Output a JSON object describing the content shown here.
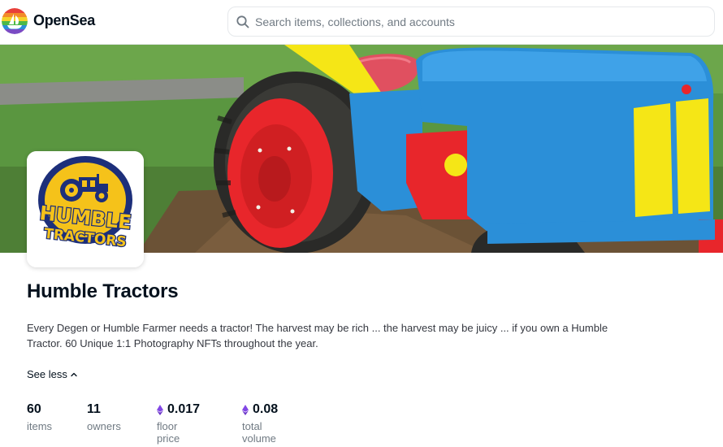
{
  "header": {
    "brand": "OpenSea",
    "logo_icon": "opensea-rainbow-logo-icon",
    "search": {
      "placeholder": "Search items, collections, and accounts",
      "value": ""
    }
  },
  "collection": {
    "name": "Humble Tractors",
    "description": "Every Degen or Humble Farmer needs a tractor! The harvest may be rich ... the harvest may be juicy ... if you own a Humble Tractor. 60 Unique 1:1 Photography NFTs throughout the year.",
    "see_less_label": "See less",
    "avatar": {
      "logo_text_line1": "HUMBLE",
      "logo_text_line2": "TRACTORS"
    }
  },
  "stats": [
    {
      "value": "60",
      "label": "items",
      "currency_icon": ""
    },
    {
      "value": "11",
      "label": "owners",
      "currency_icon": ""
    },
    {
      "value": "0.017",
      "label": "floor price",
      "currency_icon": "eth-icon"
    },
    {
      "value": "0.08",
      "label": "total volume",
      "currency_icon": "eth-icon"
    }
  ],
  "colors": {
    "eth": "#8247e5",
    "muted": "#707a83",
    "text": "#04111d",
    "tractor_blue": "#2b8fd8",
    "tractor_red": "#e8262b",
    "tractor_yellow": "#f5e616"
  }
}
